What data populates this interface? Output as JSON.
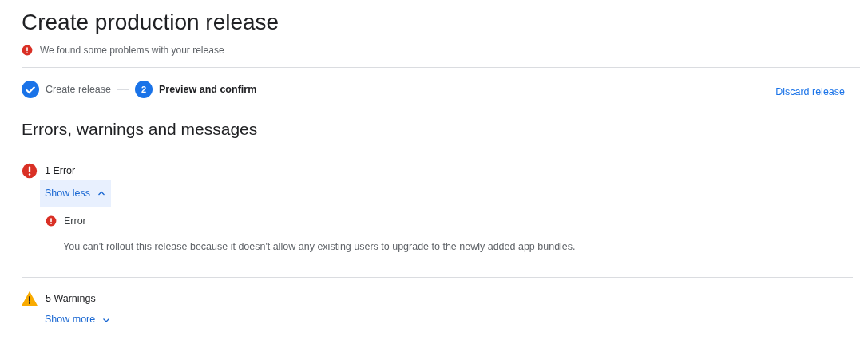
{
  "page": {
    "title": "Create production release",
    "status": "We found some problems with your release"
  },
  "steps": [
    {
      "label": "Create release",
      "kind": "done"
    },
    {
      "label": "Preview and confirm",
      "kind": "current",
      "number": "2"
    }
  ],
  "discard_link": "Discard release",
  "section": {
    "heading": "Errors, warnings and messages"
  },
  "groups": [
    {
      "kind": "error",
      "title": "1 Error",
      "toggle": "Show less",
      "expanded": true,
      "issues": [
        {
          "kind": "error",
          "title": "Error",
          "message": "You can't rollout this release because it doesn't allow any existing users to upgrade to the newly added app bundles."
        }
      ]
    },
    {
      "kind": "warning",
      "title": "5 Warnings",
      "toggle": "Show more",
      "expanded": false
    }
  ]
}
